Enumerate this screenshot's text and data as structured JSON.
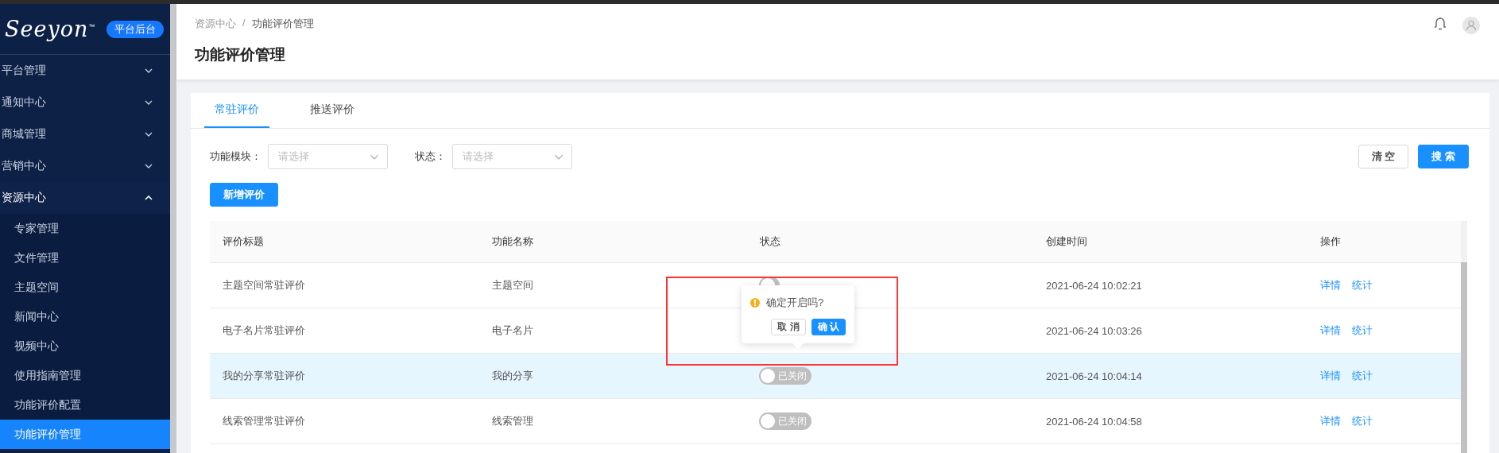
{
  "sidebar": {
    "logo": "Seeyon",
    "logo_mark": "™",
    "badge": "平台后台",
    "items": [
      {
        "label": "平台管理",
        "expanded": false
      },
      {
        "label": "通知中心",
        "expanded": false
      },
      {
        "label": "商城管理",
        "expanded": false
      },
      {
        "label": "营销中心",
        "expanded": false
      },
      {
        "label": "资源中心",
        "expanded": true,
        "children": [
          {
            "label": "专家管理",
            "selected": false
          },
          {
            "label": "文件管理",
            "selected": false
          },
          {
            "label": "主题空间",
            "selected": false
          },
          {
            "label": "新闻中心",
            "selected": false
          },
          {
            "label": "视频中心",
            "selected": false
          },
          {
            "label": "使用指南管理",
            "selected": false
          },
          {
            "label": "功能评价配置",
            "selected": false
          },
          {
            "label": "功能评价管理",
            "selected": true
          }
        ]
      }
    ]
  },
  "breadcrumb": {
    "items": [
      "资源中心",
      "功能评价管理"
    ],
    "separator": "/"
  },
  "page_title": "功能评价管理",
  "tabs": [
    {
      "label": "常驻评价",
      "selected": true
    },
    {
      "label": "推送评价",
      "selected": false
    }
  ],
  "filters": [
    {
      "label": "功能模块：",
      "placeholder": "请选择"
    },
    {
      "label": "状态：",
      "placeholder": "请选择"
    }
  ],
  "filter_buttons": [
    {
      "label": "清 空",
      "kind": "default"
    },
    {
      "label": "搜 索",
      "kind": "primary"
    }
  ],
  "add_button": "新增评价",
  "table": {
    "columns": [
      "评价标题",
      "功能名称",
      "状态",
      "创建时间",
      "操作"
    ],
    "rows": [
      {
        "title": "主题空间常驻评价",
        "function": "主题空间",
        "status": {
          "on": false
        },
        "created": "2021-06-24 10:02:21",
        "actions": [
          "详情",
          "统计"
        ],
        "highlighted": false
      },
      {
        "title": "电子名片常驻评价",
        "function": "电子名片",
        "created": "2021-06-24 10:03:26",
        "actions": [
          "详情",
          "统计"
        ],
        "highlighted": false
      },
      {
        "title": "我的分享常驻评价",
        "function": "我的分享",
        "status": {
          "on": false,
          "label": "已关闭"
        },
        "created": "2021-06-24 10:04:14",
        "actions": [
          "详情",
          "统计"
        ],
        "highlighted": true
      },
      {
        "title": "线索管理常驻评价",
        "function": "线索管理",
        "status": {
          "on": false,
          "label": "已关闭"
        },
        "created": "2021-06-24 10:04:58",
        "actions": [
          "详情",
          "统计"
        ],
        "highlighted": false
      }
    ]
  },
  "popconfirm": {
    "message": "确定开启吗?",
    "buttons": [
      {
        "label": "取 消",
        "kind": "default"
      },
      {
        "label": "确 认",
        "kind": "primary"
      }
    ]
  },
  "annotation_frame": true
}
